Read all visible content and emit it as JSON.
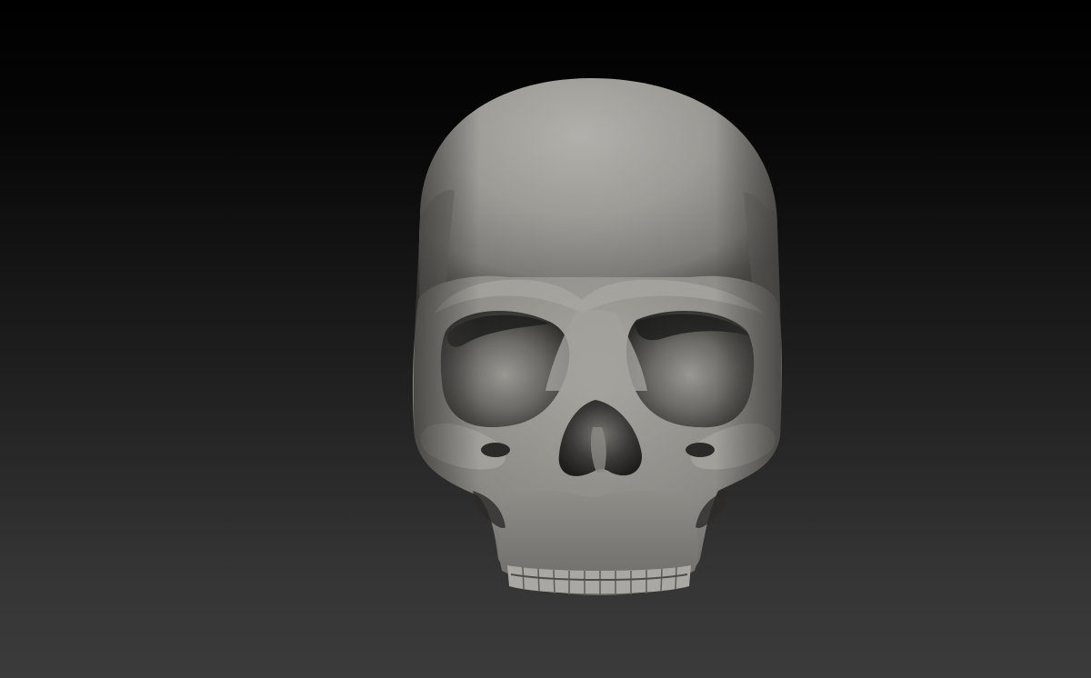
{
  "app": {
    "view": "3d-viewport",
    "model": "skull-sculpt",
    "background_gradient": [
      "#000000",
      "#3b3b3b"
    ],
    "material_color": "#9a9893"
  }
}
